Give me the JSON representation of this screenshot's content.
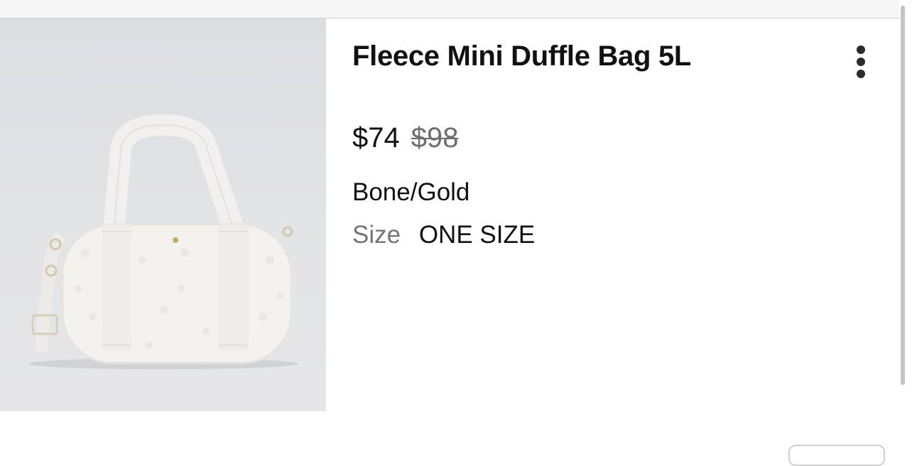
{
  "product": {
    "title": "Fleece Mini Duffle Bag 5L",
    "price_current": "$74",
    "price_original": "$98",
    "color": "Bone/Gold",
    "size_label": "Size",
    "size_value": "ONE SIZE",
    "image_icon": "product-photo-duffle-bag"
  },
  "actions": {
    "more_icon": "more-vertical-icon"
  },
  "colors": {
    "text": "#111111",
    "muted": "#757575",
    "strike": "#6f6f6f",
    "image_bg": "#e2e3e5"
  }
}
